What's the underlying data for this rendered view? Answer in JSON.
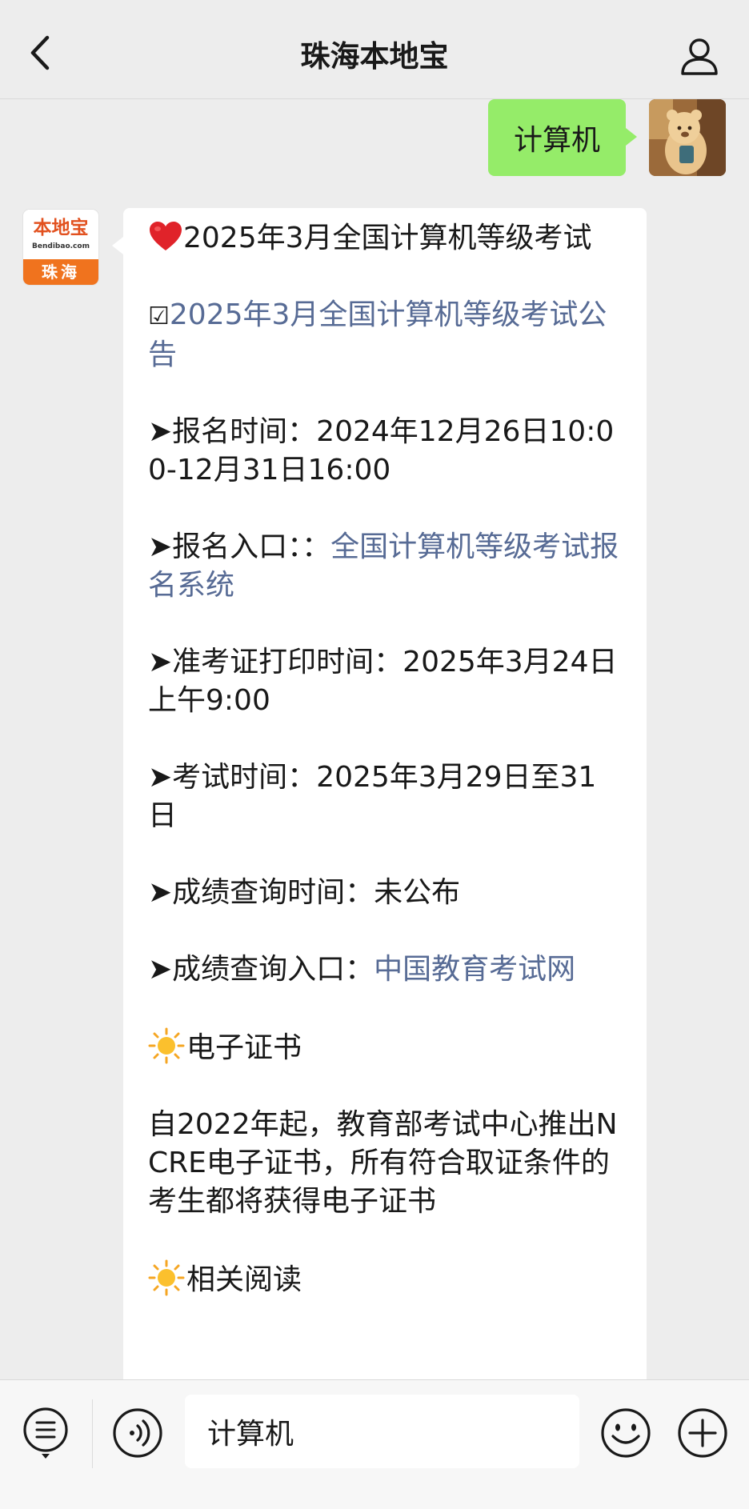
{
  "header": {
    "title": "珠海本地宝"
  },
  "chat": {
    "my_message": "计算机",
    "bot_avatar": {
      "logo_name": "本地宝",
      "logo_url": "Bendibao.com",
      "logo_city": "珠海"
    },
    "reply": {
      "line1_title": "2025年3月全国计算机等级考试",
      "line2_checkbox": "☑",
      "line2_link": "2025年3月全国计算机等级考试公告",
      "reg_time": "➤报名时间：2024年12月26日10:00-12月31日16:00",
      "reg_entry_label": "➤报名入口：：",
      "reg_entry_link": "全国计算机等级考试报名系统",
      "admit_print": "➤准考证打印时间：2025年3月24日上午9:00",
      "exam_time": "➤考试时间：2025年3月29日至31日",
      "score_time": "➤成绩查询时间：未公布",
      "score_entry_label": "➤成绩查询入口：",
      "score_entry_link": "中国教育考试网",
      "cert_heading": "电子证书",
      "cert_body": "自2022年起，教育部考试中心推出NCRE电子证书，所有符合取证条件的考生都将获得电子证书",
      "related_heading": "相关阅读"
    }
  },
  "input": {
    "value": "计算机"
  },
  "icons": {
    "back": "chevron-left-icon",
    "profile": "person-icon",
    "menu": "menu-list-icon",
    "voice": "voice-icon",
    "emoji": "smile-icon",
    "plus": "plus-icon"
  }
}
